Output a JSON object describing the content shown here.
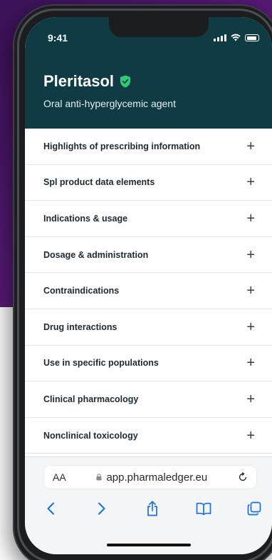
{
  "status": {
    "time": "9:41"
  },
  "product": {
    "name": "Pleritasol",
    "subtitle": "Oral anti-hyperglycemic agent"
  },
  "sections": [
    {
      "label": "Highlights of prescribing information",
      "icon": "plus-icon"
    },
    {
      "label": "Spl product data elements",
      "icon": "plus-icon"
    },
    {
      "label": "Indications & usage",
      "icon": "plus-icon"
    },
    {
      "label": "Dosage & administration",
      "icon": "plus-icon"
    },
    {
      "label": "Contraindications",
      "icon": "plus-icon"
    },
    {
      "label": "Drug interactions",
      "icon": "plus-icon"
    },
    {
      "label": "Use in specific populations",
      "icon": "plus-icon"
    },
    {
      "label": "Clinical pharmacology",
      "icon": "plus-icon"
    },
    {
      "label": "Nonclinical toxicology",
      "icon": "plus-icon"
    }
  ],
  "browser": {
    "text_size_label": "AA",
    "url": "app.pharmaledger.eu",
    "toolbar": [
      "back-icon",
      "forward-icon",
      "share-icon",
      "bookmarks-icon",
      "tabs-icon"
    ]
  },
  "colors": {
    "header_bg": "#0f3b45",
    "shield_accent": "#2ecc71",
    "browser_tint": "#1a6fe0",
    "backdrop": "#4a156b"
  }
}
